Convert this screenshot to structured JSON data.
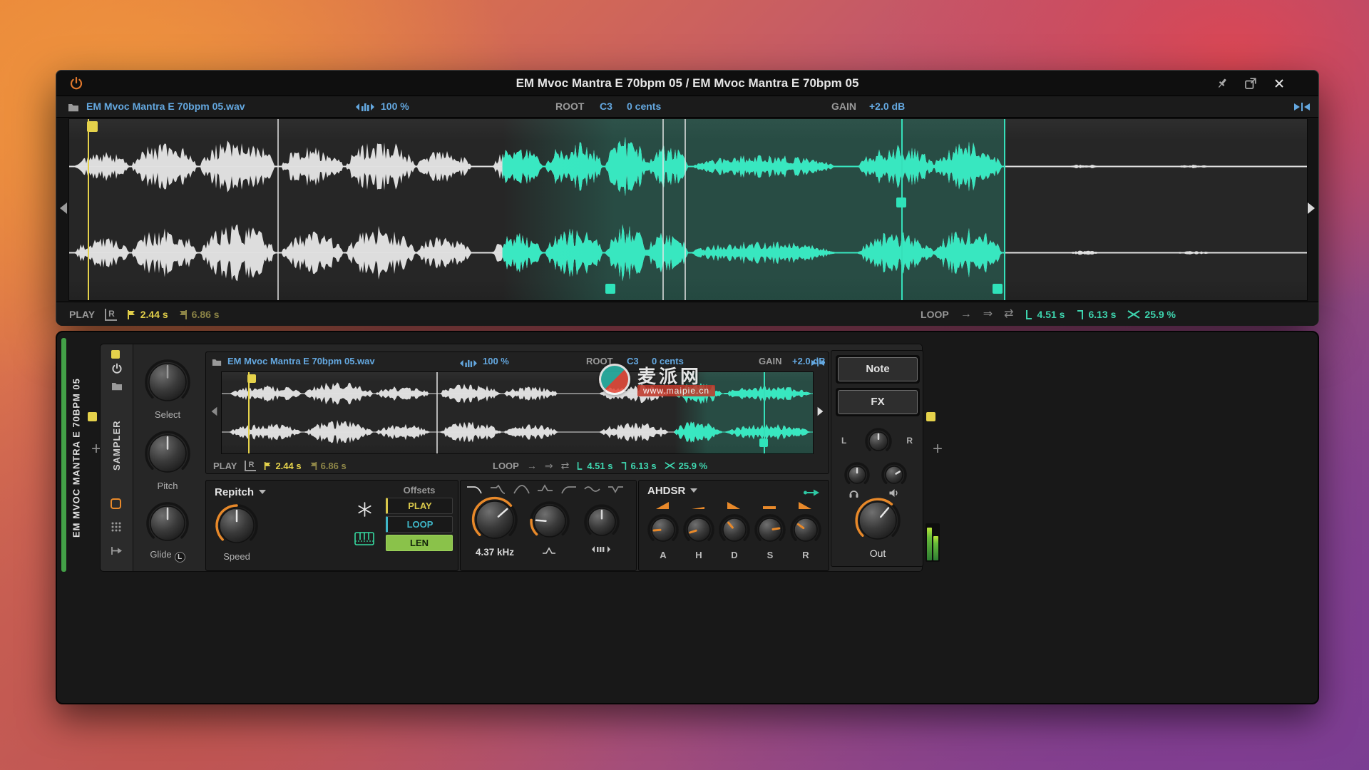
{
  "editor_window": {
    "title": "EM Mvoc Mantra E 70bpm 05 / EM Mvoc Mantra E 70bpm 05"
  },
  "sample": {
    "file_name": "EM Mvoc Mantra E 70bpm 05.wav",
    "stretch": "100 %",
    "root_label": "ROOT",
    "root_note": "C3",
    "root_cents": "0 cents",
    "gain_label": "GAIN",
    "gain_value": "+2.0 dB",
    "play_label": "PLAY",
    "play_mode": "R",
    "play_start": "2.44 s",
    "play_end": "6.86 s",
    "loop_label": "LOOP",
    "loop_start": "4.51 s",
    "loop_length": "6.13 s",
    "loop_crossfade": "25.9 %"
  },
  "device": {
    "track_name": "EM MVOC MANTRA E 70BPM 05",
    "device_name": "SAMPLER",
    "add_label": "+",
    "knobs": {
      "select": "Select",
      "pitch": "Pitch",
      "glide": "Glide",
      "glide_badge": "L",
      "speed": "Speed",
      "out": "Out"
    },
    "mode_label": "Repitch",
    "offsets": {
      "header": "Offsets",
      "play": "PLAY",
      "loop": "LOOP",
      "len": "LEN"
    },
    "filter": {
      "freq": "4.37 kHz"
    },
    "envelope": {
      "header": "AHDSR",
      "stages": [
        "A",
        "H",
        "D",
        "S",
        "R"
      ]
    },
    "buttons": {
      "note": "Note",
      "fx": "FX"
    },
    "pan": {
      "left": "L",
      "right": "R"
    }
  },
  "watermark": {
    "name": "麦派网",
    "url": "www.maipie.cn"
  },
  "colors": {
    "accent_teal": "#2fe3ba",
    "marker_yellow": "#e5d24b",
    "value_blue": "#64a8e0",
    "knob_orange": "#e8892a",
    "len_green": "#8ac24a",
    "meter_green": "#66bb3a"
  }
}
